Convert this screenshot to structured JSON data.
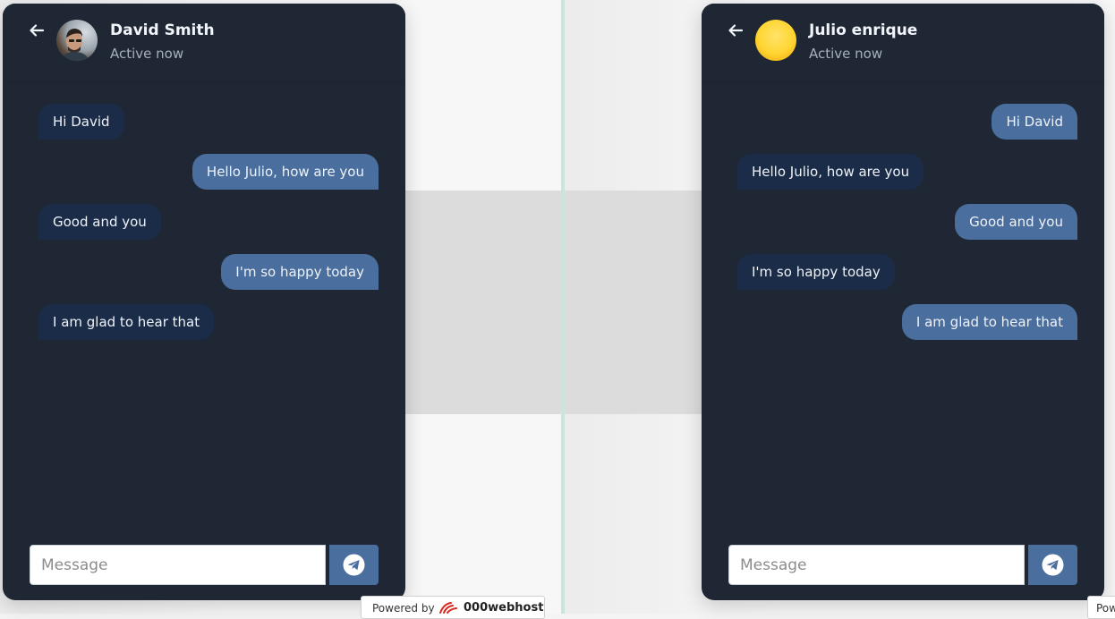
{
  "left_chat": {
    "contact_name": "David Smith",
    "status": "Active now",
    "messages": [
      {
        "text": "Hi David",
        "direction": "incoming"
      },
      {
        "text": "Hello Julio, how are you",
        "direction": "outgoing"
      },
      {
        "text": "Good and you",
        "direction": "incoming"
      },
      {
        "text": "I'm so happy today",
        "direction": "outgoing"
      },
      {
        "text": "I am glad to hear that",
        "direction": "incoming"
      }
    ],
    "input_placeholder": "Message"
  },
  "right_chat": {
    "contact_name": "Julio enrique",
    "status": "Active now",
    "messages": [
      {
        "text": "Hi David",
        "direction": "outgoing"
      },
      {
        "text": "Hello Julio, how are you",
        "direction": "incoming"
      },
      {
        "text": "Good and you",
        "direction": "outgoing"
      },
      {
        "text": "I'm so happy today",
        "direction": "incoming"
      },
      {
        "text": "I am glad to hear that",
        "direction": "outgoing"
      }
    ],
    "input_placeholder": "Message"
  },
  "footer": {
    "powered_by": "Powered by",
    "brand": "000webhost",
    "powered_by_clipped": "Pow"
  },
  "icons": {
    "back": "arrow-left-icon",
    "send": "telegram-send-icon",
    "brand_logo": "000webhost-logo-icon"
  },
  "colors": {
    "panel_bg": "#1e2733",
    "incoming_bubble": "#1b2c48",
    "outgoing_bubble": "#4a6e9e",
    "send_button": "#4a6e9e",
    "divider": "#c8e6df"
  }
}
